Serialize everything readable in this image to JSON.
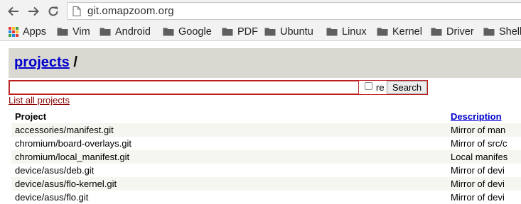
{
  "browser": {
    "url": "git.omapzoom.org",
    "bookmarks": [
      {
        "label": "Apps",
        "icon": "apps-grid-icon"
      },
      {
        "label": "Vim",
        "icon": "folder-icon"
      },
      {
        "label": "Android",
        "icon": "folder-icon"
      },
      {
        "label": "Google",
        "icon": "folder-icon"
      },
      {
        "label": "PDF",
        "icon": "folder-icon"
      },
      {
        "label": "Ubuntu",
        "icon": "folder-icon"
      },
      {
        "label": "Linux",
        "icon": "folder-icon"
      },
      {
        "label": "Kernel",
        "icon": "folder-icon"
      },
      {
        "label": "Driver",
        "icon": "folder-icon"
      },
      {
        "label": "Shell",
        "icon": "folder-icon"
      }
    ]
  },
  "header": {
    "projects_link": "projects",
    "separator": " /"
  },
  "search": {
    "value": "",
    "re_label": "re",
    "button_label": "Search"
  },
  "list_all_label": "List all projects",
  "table": {
    "col_project": "Project",
    "col_description": "Description",
    "rows": [
      {
        "project": "accessories/manifest.git",
        "description": "Mirror of man"
      },
      {
        "project": "chromium/board-overlays.git",
        "description": "Mirror of src/c"
      },
      {
        "project": "chromium/local_manifest.git",
        "description": "Local manifes"
      },
      {
        "project": "device/asus/deb.git",
        "description": "Mirror of devi"
      },
      {
        "project": "device/asus/flo-kernel.git",
        "description": "Mirror of devi"
      },
      {
        "project": "device/asus/flo.git",
        "description": "Mirror of devi"
      }
    ]
  },
  "colors": {
    "header_bg": "#d9d8d1",
    "link_blue": "#0000cc",
    "list_all_link": "#880000",
    "search_border": "#c01818",
    "row_stripe": "#f6f6f0"
  }
}
